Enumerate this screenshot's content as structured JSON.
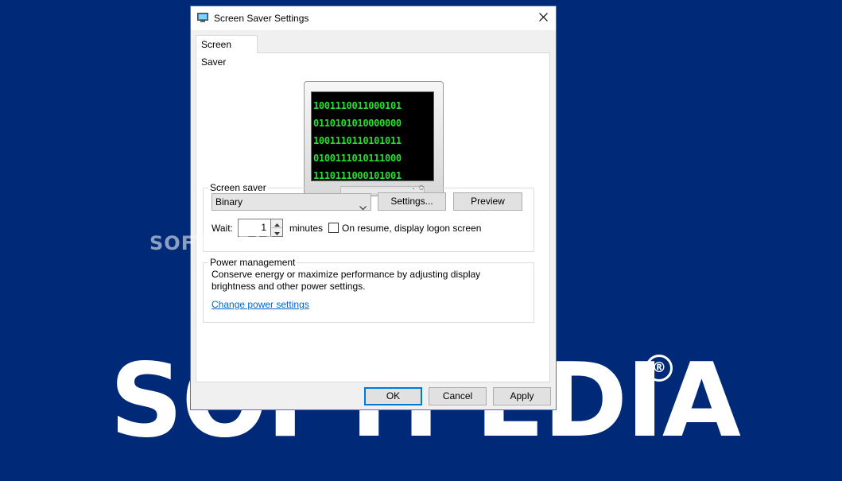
{
  "wallpaper": {
    "logo_text": "SOFTPEDIA",
    "registered_mark": "®",
    "watermark_text": "SOFTPEDIA",
    "background_color": "#002a78"
  },
  "dialog": {
    "title": "Screen Saver Settings",
    "title_icon": "screen-saver-icon",
    "close_icon": "close-icon",
    "tab_label": "Screen Saver",
    "preview": {
      "lines": [
        "1001110011000101",
        "0110101010000000",
        "1001110110101011",
        "0100111010111000",
        "1110111000101001"
      ],
      "text_color": "#22e22e"
    },
    "screen_saver_group": {
      "legend": "Screen saver",
      "selected": "Binary",
      "settings_label": "Settings...",
      "preview_label": "Preview",
      "wait_label": "Wait:",
      "wait_value": "1",
      "minutes_label": "minutes",
      "logon_checkbox_label": "On resume, display logon screen",
      "logon_checked": false
    },
    "power_group": {
      "legend": "Power management",
      "description": "Conserve energy or maximize performance by adjusting display brightness and other power settings.",
      "link_label": "Change power settings",
      "link_color": "#0066cc"
    },
    "footer": {
      "ok_label": "OK",
      "cancel_label": "Cancel",
      "apply_label": "Apply"
    }
  }
}
